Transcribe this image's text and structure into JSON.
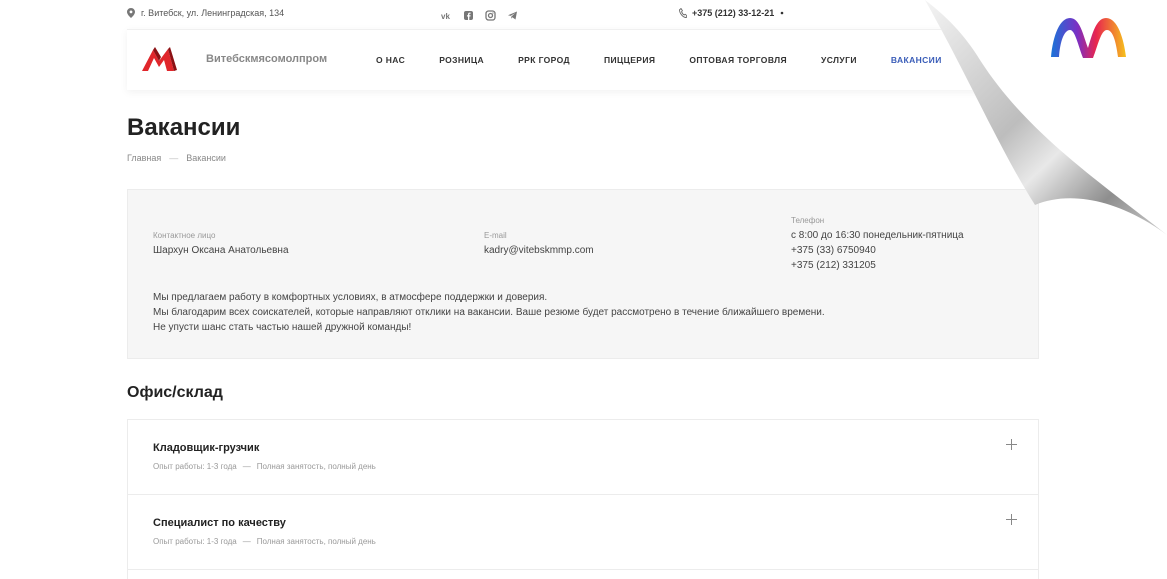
{
  "topbar": {
    "address": "г. Витебск, ул. Ленинградская, 134",
    "social": [
      "vk-icon",
      "facebook-icon",
      "instagram-icon",
      "telegram-icon"
    ],
    "phone": "+375 (212) 33-12-21"
  },
  "header": {
    "brand": "Витебскмясомолпром",
    "nav": [
      {
        "label": "О НАС",
        "active": false
      },
      {
        "label": "РОЗНИЦА",
        "active": false
      },
      {
        "label": "РРК ГОРОД",
        "active": false
      },
      {
        "label": "ПИЦЦЕРИЯ",
        "active": false
      },
      {
        "label": "ОПТОВАЯ ТОРГОВЛЯ",
        "active": false
      },
      {
        "label": "УСЛУГИ",
        "active": false
      },
      {
        "label": "ВАКАНСИИ",
        "active": true
      }
    ]
  },
  "page": {
    "title": "Вакансии",
    "breadcrumb": [
      "Главная",
      "Вакансии"
    ]
  },
  "contact": {
    "person_label": "Контактное лицо",
    "person": "Шархун Оксана Анатольевна",
    "email_label": "E-mail",
    "email": "kadry@vitebskmmp.com",
    "phone_label": "Телефон",
    "phone_hours": "с 8:00 до 16:30 понедельник-пятница",
    "phone1": "+375 (33) 6750940",
    "phone2": "+375 (212) 331205",
    "text": [
      "Мы предлагаем работу в комфортных условиях, в атмосфере поддержки и доверия.",
      "Мы благодарим всех соискателей, которые направляют отклики на вакансии. Ваше резюме будет рассмотрено в течение ближайшего времени.",
      "Не упусти шанс стать частью нашей дружной команды!"
    ]
  },
  "section": {
    "title": "Офис/склад",
    "vacancies": [
      {
        "title": "Кладовщик-грузчик",
        "experience": "Опыт работы: 1-3 года",
        "sep": "—",
        "employment": "Полная занятость, полный день"
      },
      {
        "title": "Специалист по качеству",
        "experience": "Опыт работы: 1-3 года",
        "sep": "—",
        "employment": "Полная занятость, полный день"
      }
    ]
  },
  "colors": {
    "accent": "#3a5db8",
    "logo_red": "#e0262b"
  }
}
